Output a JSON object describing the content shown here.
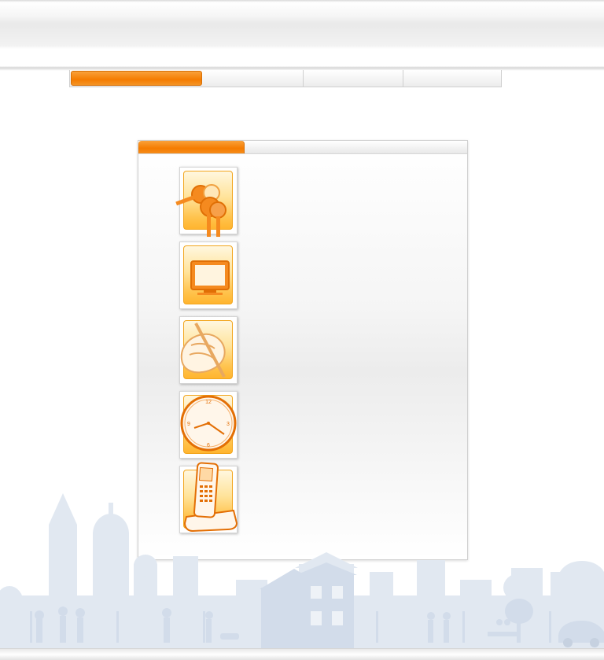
{
  "theme": {
    "accent": "#f57c00",
    "accent_light": "#ffc34d",
    "skyline": "#dfe6ef"
  },
  "nav": {
    "tabs": [
      {
        "label": "",
        "active": true
      },
      {
        "label": "",
        "active": false
      },
      {
        "label": "",
        "active": false
      },
      {
        "label": "",
        "active": false
      }
    ]
  },
  "panel": {
    "tab_label": "",
    "icons": [
      {
        "name": "keys-icon"
      },
      {
        "name": "monitor-icon"
      },
      {
        "name": "signing-hand-icon"
      },
      {
        "name": "clock-icon"
      },
      {
        "name": "cordless-phone-icon"
      }
    ]
  }
}
